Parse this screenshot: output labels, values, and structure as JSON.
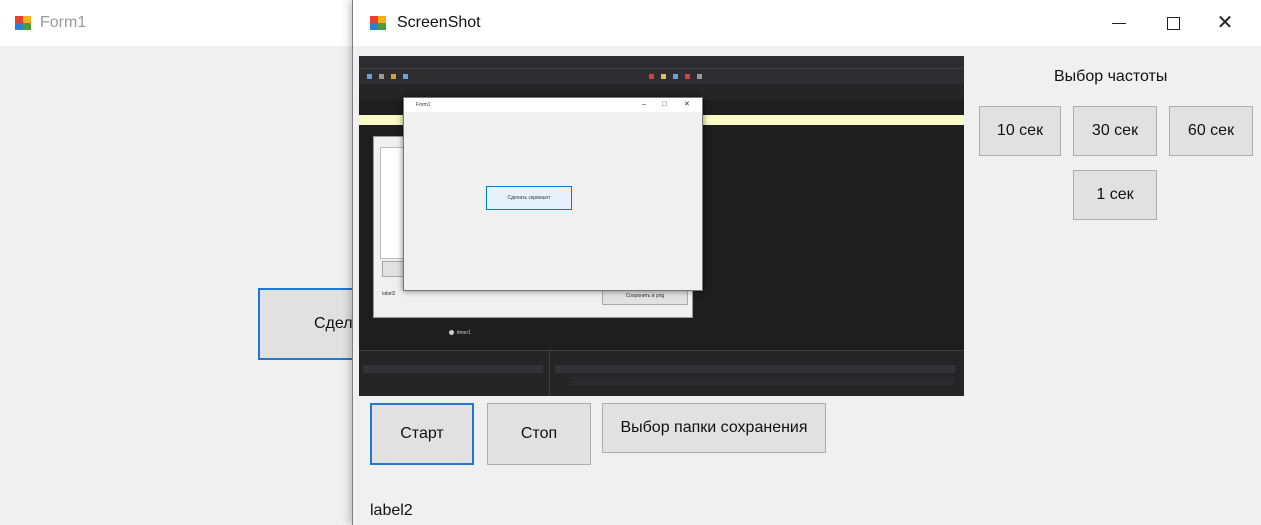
{
  "form1": {
    "title": "Form1",
    "button_label": "Сдела"
  },
  "screenshot_window": {
    "title": "ScreenShot",
    "controls": {
      "minimize": "minimize-icon",
      "maximize": "maximize-icon",
      "close": "close-icon"
    }
  },
  "preview": {
    "inner_form_title": "Form1",
    "inner_form_button": "Сделать скриншот",
    "designer_save_button": "Сохранить в png",
    "designer_label": "label2",
    "timer_component": "timer1"
  },
  "frequency": {
    "label": "Выбор частоты",
    "options": [
      "10 сек",
      "30 сек",
      "60 сек",
      "1 сек"
    ]
  },
  "actions": {
    "start": "Старт",
    "stop": "Стоп",
    "choose_folder": "Выбор папки сохранения"
  },
  "status_label": "label2",
  "colors": {
    "accent": "#1e78d4",
    "window_bg": "#f0f0f0",
    "button_bg": "#e1e1e1",
    "ide_bg": "#1e1e1e"
  }
}
